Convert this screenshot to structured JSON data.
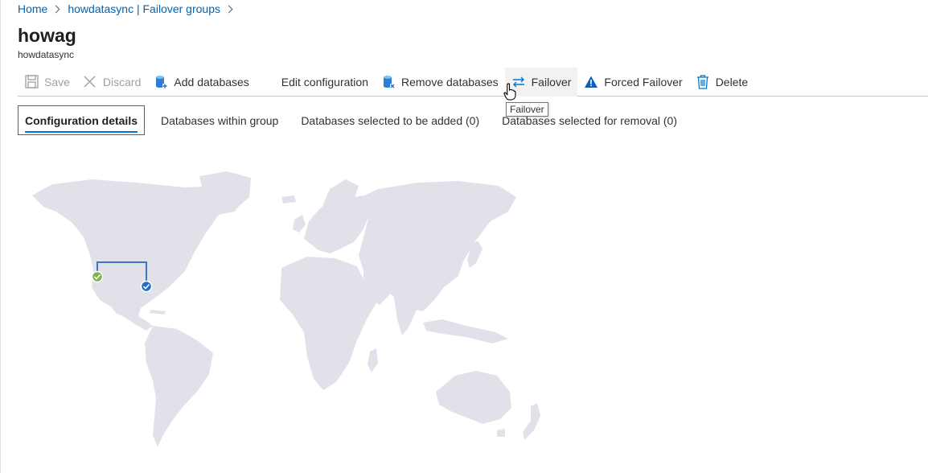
{
  "breadcrumb": {
    "items": [
      {
        "label": "Home"
      },
      {
        "label": "howdatasync | Failover groups"
      }
    ]
  },
  "header": {
    "title": "howag",
    "subtitle": "howdatasync"
  },
  "toolbar": {
    "save_label": "Save",
    "discard_label": "Discard",
    "add_databases_label": "Add databases",
    "edit_configuration_label": "Edit configuration",
    "remove_databases_label": "Remove databases",
    "failover_label": "Failover",
    "forced_failover_label": "Forced Failover",
    "delete_label": "Delete"
  },
  "tooltip": {
    "text": "Failover"
  },
  "tabs": [
    {
      "label": "Configuration details",
      "active": true
    },
    {
      "label": "Databases within group",
      "active": false
    },
    {
      "label": "Databases selected to be added (0)",
      "active": false
    },
    {
      "label": "Databases selected for removal (0)",
      "active": false
    }
  ],
  "map": {
    "land_color": "#e1e2e9",
    "link_color": "#4472c4",
    "primary_status": "green-check-icon",
    "secondary_status": "blue-check-icon"
  },
  "colors": {
    "link": "#0063b1",
    "accent": "#0078d4",
    "check_green": "#7ab648",
    "check_blue": "#1f6fc5",
    "warning_blue": "#0f5fb8"
  }
}
